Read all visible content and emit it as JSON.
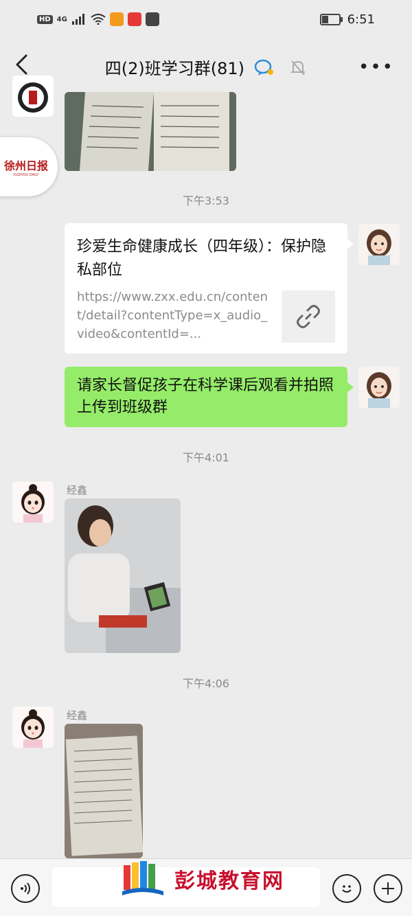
{
  "status_bar": {
    "hd": "HD",
    "network": "4G",
    "time": "6:51"
  },
  "header": {
    "title": "四(2)班学习群(81)"
  },
  "floating_logo": {
    "text": "徐州日报",
    "sub": "XUZHOU DAILY"
  },
  "messages": {
    "time_1": "下午3:53",
    "card": {
      "title": "珍爱生命健康成长（四年级）：保护隐私部位",
      "url": "https://www.zxx.edu.cn/content/detail?contentType=x_audio_video&contentId=..."
    },
    "green_text": "请家长督促孩子在科学课后观看并拍照上传到班级群",
    "time_2": "下午4:01",
    "sender_1": "经鑫",
    "time_3": "下午4:06",
    "sender_2": "经鑫"
  },
  "bottom_bar": {
    "watermark": "彭城教育网"
  },
  "colors": {
    "background": "#ececec",
    "self_bubble": "#95ec69",
    "watermark": "#c8102e"
  }
}
